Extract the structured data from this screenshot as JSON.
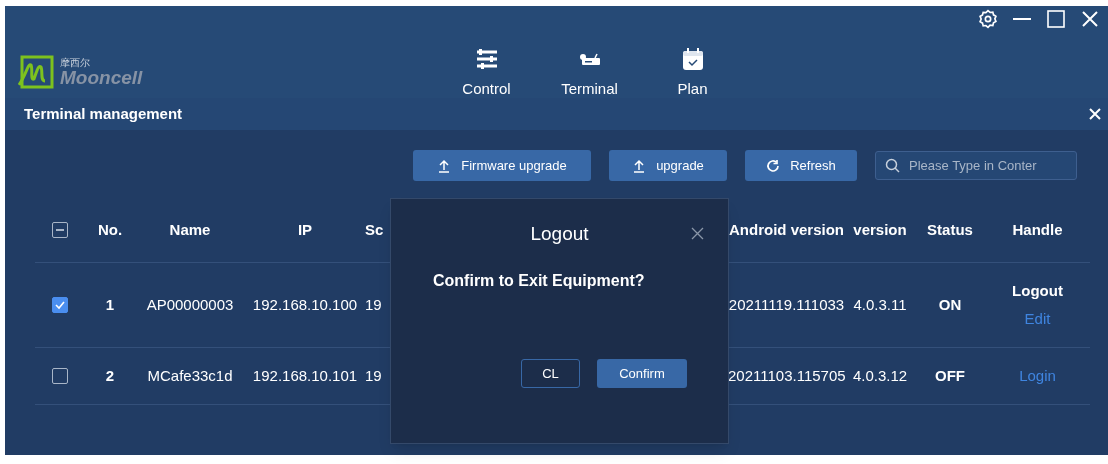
{
  "header": {
    "logo": {
      "brand_cn": "摩西尔",
      "brand": "Mooncell"
    },
    "nav": [
      {
        "label": "Control",
        "kind": "sliders"
      },
      {
        "label": "Terminal",
        "kind": "device"
      },
      {
        "label": "Plan",
        "kind": "calendar"
      }
    ]
  },
  "panel": {
    "title": "Terminal management"
  },
  "toolbar": {
    "buttons": [
      {
        "label": "Firmware upgrade",
        "kind": "upload"
      },
      {
        "label": "upgrade",
        "kind": "upload"
      },
      {
        "label": "Refresh",
        "kind": "refresh"
      }
    ],
    "search": {
      "placeholder": "Please Type in Conter"
    }
  },
  "table": {
    "select_all_indeterminate": true,
    "columns": [
      "No.",
      "Name",
      "IP",
      "Sc",
      "Android version",
      "version",
      "Status",
      "Handle"
    ],
    "rows": [
      {
        "checked": true,
        "cells": [
          "1",
          "AP00000003",
          "192.168.10.100",
          "19",
          "20211119.111033",
          "4.0.3.11",
          "ON"
        ],
        "actions": [
          {
            "label": "Logout",
            "kind": "plain"
          },
          {
            "label": "Edit",
            "kind": "link"
          }
        ]
      },
      {
        "checked": false,
        "cells": [
          "2",
          "MCafe33c1d",
          "192.168.10.101",
          "19",
          "20211103.115705",
          "4.0.3.12",
          "OFF"
        ],
        "actions": [
          {
            "label": "Login",
            "kind": "link"
          }
        ]
      }
    ]
  },
  "dialog": {
    "title": "Logout",
    "message": "Confirm to Exit Equipment?",
    "buttons": [
      {
        "label": "CL",
        "kind": "secondary"
      },
      {
        "label": "Confirm",
        "kind": "primary"
      }
    ]
  }
}
